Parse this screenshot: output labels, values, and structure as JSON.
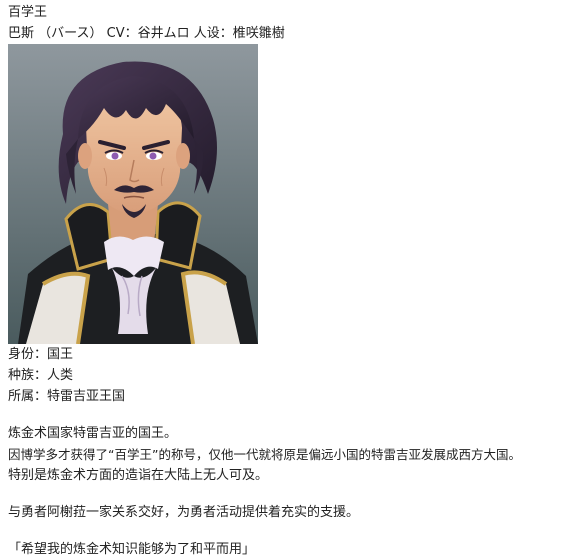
{
  "character": {
    "title": "百学王",
    "credits": "巴斯 （バース） CV：谷井ムロ 人设：椎咲雛樹",
    "portrait": {
      "description": "illustrated portrait",
      "colors": {
        "background_top": "#8a949a",
        "background_bottom": "#4e5f62",
        "hair": "#3a2d44",
        "skin": "#e8b893",
        "coat": "#1d1f22",
        "gold_trim": "#c9a24a",
        "cravat": "#ece6f2",
        "eyes": "#8e5bb0"
      }
    },
    "profile": {
      "identity": "身份：国王",
      "race": "种族：人类",
      "affiliation": "所属：特雷吉亚王国"
    },
    "description": {
      "line1": "炼金术国家特雷吉亚的国王。",
      "line2": "因博学多才获得了“百学王”的称号，仅他一代就将原是偏远小国的特雷吉亚发展成西方大国。",
      "line3": "特别是炼金术方面的造诣在大陆上无人可及。",
      "line4": "与勇者阿榭菈一家关系交好，为勇者活动提供着充实的支援。"
    },
    "quote": "「希望我的炼金术知识能够为了和平而用」"
  }
}
